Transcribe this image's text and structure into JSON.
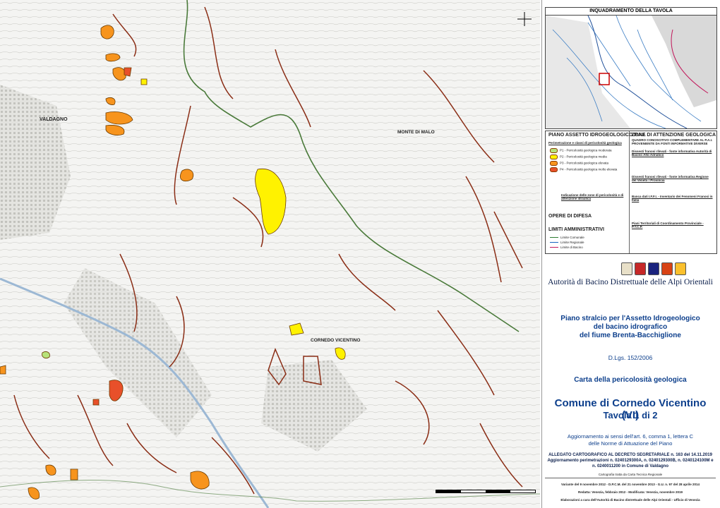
{
  "map": {
    "places": [
      {
        "name": "valdagno",
        "label": "VALDAGNO"
      },
      {
        "name": "monte-di-malo",
        "label": "MONTE DI MALO"
      },
      {
        "name": "cornedo-vicentino",
        "label": "CORNEDO VICENTINO"
      }
    ]
  },
  "inset": {
    "title": "INQUADRAMENTO DELLA TAVOLA"
  },
  "legend": {
    "left_title": "PIANO ASSETTO IDROGEOLOGICO P.A.I.",
    "left_subtitle": "Perimetrazione e classi di pericolosità geologica",
    "classes": [
      {
        "label": "P1 - Pericolosità geologica moderata",
        "color": "#b7e37a"
      },
      {
        "label": "P2 - Pericolosità geologica media",
        "color": "#fff200"
      },
      {
        "label": "P3 - Pericolosità geologica elevata",
        "color": "#f7941d"
      },
      {
        "label": "P4 - Pericolosità geologica molto elevata",
        "color": "#e8502a"
      }
    ],
    "indicator_label": "Indicazione delle zone di pericolosità e di attenzione idraulica",
    "opere_title": "OPERE DI DIFESA",
    "limiti_title": "LIMITI AMMINISTRATIVI",
    "limiti": [
      {
        "label": "Limite Comunale",
        "color": "#2e7d32"
      },
      {
        "label": "Limite Regionale",
        "color": "#1565c0"
      },
      {
        "label": "Limite di Bacino",
        "color": "#c2185b"
      }
    ],
    "right_title": "ZONE DI ATTENZIONE GEOLOGICA",
    "right_subtitle": "QUADRO CONOSCITIVO COMPLEMENTARE AL P.A.I. PROVENIENTE DA FONTI INFORMATIVE DIVERSE",
    "dissesti1": "Dissesti franosi rilevati - fonte informativa Autorità di Bacino Alto Adriatico",
    "dissesti2": "Dissesti franosi rilevati - fonte informativa Regione del Veneto / Provincia",
    "banca": "Banca dati I.F.F.I. - Inventario dei Fenomeni Franosi in Italia",
    "ptcp": "Piani Territoriali di Coordinamento Provinciale - P.T.C.P."
  },
  "authority": "Autorità di Bacino Distrettuale delle Alpi Orientali",
  "plan_title": [
    "Piano stralcio per l'Assetto Idrogeologico",
    "del bacino idrografico",
    "del fiume Brenta-Bacchiglione"
  ],
  "decree": "D.Lgs. 152/2006",
  "map_type": "Carta della pericolosità geologica",
  "comune": "Comune di Cornedo Vicentino (VI)",
  "tavola": "Tavola 1 di 2",
  "update": [
    "Aggiornamento ai sensi dell'art. 6, comma 1, lettera C",
    "delle Norme di Attuazione del Piano"
  ],
  "allegato": [
    "ALLEGATO CARTOGRAFICO AL DECRETO SEGRETARIALE n. 163 del 14.11.2019",
    "Aggiornamento perimetrazioni n. 0240129300A, n. 0240129300B, n. 0240124100M e",
    "n. 0240011200 in Comune di Valdagno"
  ],
  "footer": [
    "Cartografia tratta da Carta Tecnica Regionale",
    "Variante del 9 novembre 2012 - D.P.C.M. del 21 novembre 2013 - G.U. n. 97 del 28 aprile 2014",
    "Redatta: Venezia, febbraio 2012 - Modificata: Venezia, novembre 2019",
    "Elaborazioni a cura dell'Autorità di Bacino distrettuale delle Alpi Orientali - Ufficio di Venezia"
  ]
}
